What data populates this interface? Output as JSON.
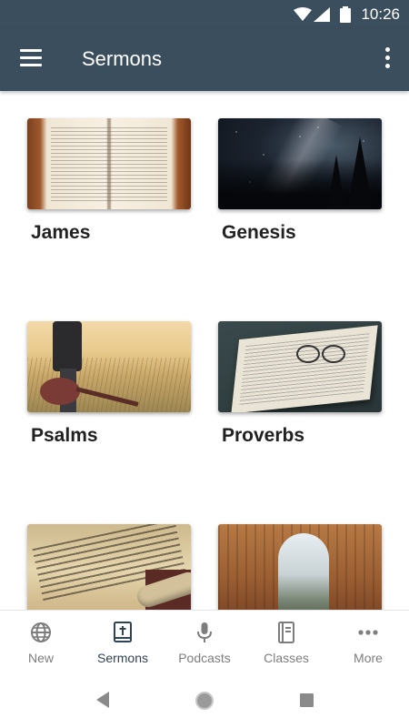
{
  "status_bar": {
    "time": "10:26",
    "icons": [
      "wifi-icon",
      "signal-icon",
      "battery-icon"
    ]
  },
  "toolbar": {
    "menu_icon": "hamburger-menu-icon",
    "title": "Sermons",
    "overflow_icon": "more-vert-icon",
    "background_color": "#3a4e5e"
  },
  "series": [
    {
      "title": "James",
      "image": "open-bible-photo"
    },
    {
      "title": "Genesis",
      "image": "milky-way-night-sky-photo"
    },
    {
      "title": "Psalms",
      "image": "person-with-guitar-in-field-photo"
    },
    {
      "title": "Proverbs",
      "image": "open-book-with-glasses-photo"
    },
    {
      "title": "",
      "image": "hebrew-scroll-photo"
    },
    {
      "title": "",
      "image": "stone-arch-window-photo"
    }
  ],
  "bottom_nav": {
    "items": [
      {
        "label": "New",
        "icon": "globe-icon",
        "active": false
      },
      {
        "label": "Sermons",
        "icon": "bible-cross-icon",
        "active": true
      },
      {
        "label": "Podcasts",
        "icon": "microphone-icon",
        "active": false
      },
      {
        "label": "Classes",
        "icon": "book-icon",
        "active": false
      },
      {
        "label": "More",
        "icon": "more-horiz-icon",
        "active": false
      }
    ],
    "active_color": "#2f4455",
    "inactive_color": "#7d7d7d"
  },
  "system_nav": {
    "icons": [
      "back-triangle-icon",
      "home-circle-icon",
      "recents-square-icon"
    ]
  }
}
